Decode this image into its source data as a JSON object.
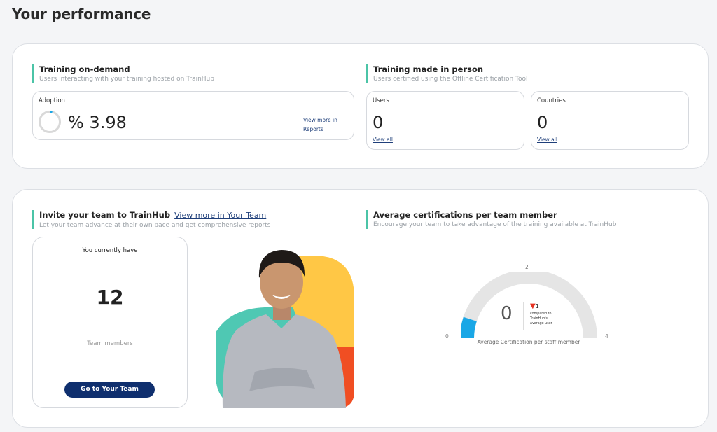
{
  "page": {
    "title": "Your performance"
  },
  "ondemand": {
    "title": "Training on-demand",
    "subtitle": "Users interacting with your training hosted on TrainHub",
    "adoption": {
      "label": "Adoption",
      "value_text": "% 3.98",
      "value": 3.98,
      "link": "View more in Reports"
    }
  },
  "inperson": {
    "title": "Training made in person",
    "subtitle": "Users certified using the Offline Certification Tool",
    "users": {
      "label": "Users",
      "value": "0",
      "link": "View all"
    },
    "countries": {
      "label": "Countries",
      "value": "0",
      "link": "View all"
    }
  },
  "invite": {
    "title": "Invite your team to TrainHub",
    "link": "View more in Your Team",
    "subtitle": "Let your team advance at their own pace and get comprehensive reports",
    "intro": "You currently have",
    "count": "12",
    "count_label": "Team members",
    "button": "Go to Your Team"
  },
  "avg": {
    "title": "Average certifications per team member",
    "subtitle": "Encourage your team to take advantage of the training available at TrainHub",
    "gauge": {
      "min_label": "0",
      "mid_label": "2",
      "max_label": "4",
      "min": 0,
      "max": 4,
      "fill_fraction": 0.1,
      "value": "0",
      "delta": "1",
      "compare_line1": "compared to",
      "compare_line2": "TrainHub's",
      "compare_line3": "average user",
      "caption": "Average Certification per staff member"
    }
  },
  "colors": {
    "accent_bar": "#4bc4a7",
    "button": "#0f2f6e",
    "gauge_fill": "#1aa7e6",
    "gauge_track": "#e5e5e5",
    "down_arrow": "#e53222",
    "blob_yellow": "#ffc745",
    "blob_teal": "#4fc8b3",
    "blob_orange": "#f04e23"
  }
}
